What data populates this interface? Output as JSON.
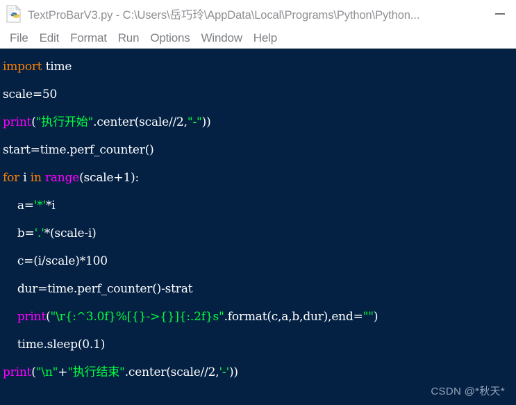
{
  "window": {
    "title": "TextProBarV3.py - C:\\Users\\岳巧玲\\AppData\\Local\\Programs\\Python\\Python...",
    "file_icon": "python-file-icon",
    "controls": [
      {
        "name": "minimize-button",
        "glyph": "minimize"
      }
    ]
  },
  "menubar": {
    "items": [
      {
        "label": "File"
      },
      {
        "label": "Edit"
      },
      {
        "label": "Format"
      },
      {
        "label": "Run"
      },
      {
        "label": "Options"
      },
      {
        "label": "Window"
      },
      {
        "label": "Help"
      }
    ]
  },
  "editor": {
    "background_color": "#042144",
    "colors": {
      "keyword": "#ff8000",
      "builtin": "#ff00ff",
      "string": "#00ff3c",
      "plain": "#ffffff"
    },
    "lines": [
      {
        "indent": "",
        "tokens": [
          {
            "t": "import",
            "c": "kw"
          },
          {
            "t": " time",
            "c": "pl"
          }
        ]
      },
      {
        "indent": "",
        "tokens": [
          {
            "t": "scale=50",
            "c": "pl"
          }
        ]
      },
      {
        "indent": "",
        "tokens": [
          {
            "t": "print",
            "c": "bi"
          },
          {
            "t": "(",
            "c": "pl"
          },
          {
            "t": "\"执行开始\"",
            "c": "str"
          },
          {
            "t": ".center(scale//2,",
            "c": "pl"
          },
          {
            "t": "\"-\"",
            "c": "str"
          },
          {
            "t": "))",
            "c": "pl"
          }
        ]
      },
      {
        "indent": "",
        "tokens": [
          {
            "t": "start=time.perf_counter()",
            "c": "pl"
          }
        ]
      },
      {
        "indent": "",
        "tokens": [
          {
            "t": "for",
            "c": "kw"
          },
          {
            "t": " i ",
            "c": "pl"
          },
          {
            "t": "in",
            "c": "kw"
          },
          {
            "t": " ",
            "c": "pl"
          },
          {
            "t": "range",
            "c": "bi"
          },
          {
            "t": "(scale+1):",
            "c": "pl"
          }
        ]
      },
      {
        "indent": "    ",
        "tokens": [
          {
            "t": "a=",
            "c": "pl"
          },
          {
            "t": "'*'",
            "c": "str"
          },
          {
            "t": "*i",
            "c": "pl"
          }
        ]
      },
      {
        "indent": "    ",
        "tokens": [
          {
            "t": "b=",
            "c": "pl"
          },
          {
            "t": "'.'",
            "c": "str"
          },
          {
            "t": "*(scale-i)",
            "c": "pl"
          }
        ]
      },
      {
        "indent": "    ",
        "tokens": [
          {
            "t": "c=(i/scale)*100",
            "c": "pl"
          }
        ]
      },
      {
        "indent": "    ",
        "tokens": [
          {
            "t": "dur=time.perf_counter()-strat",
            "c": "pl"
          }
        ]
      },
      {
        "indent": "    ",
        "tokens": [
          {
            "t": "print",
            "c": "bi"
          },
          {
            "t": "(",
            "c": "pl"
          },
          {
            "t": "\"\\r{:^3.0f}%[{}->{}]{:.2f}s\"",
            "c": "str"
          },
          {
            "t": ".format(c,a,b,dur),end=",
            "c": "pl"
          },
          {
            "t": "\"\"",
            "c": "str"
          },
          {
            "t": ")",
            "c": "pl"
          }
        ]
      },
      {
        "indent": "    ",
        "tokens": [
          {
            "t": "time.sleep(0.1)",
            "c": "pl"
          }
        ]
      },
      {
        "indent": "",
        "tokens": [
          {
            "t": "print",
            "c": "bi"
          },
          {
            "t": "(",
            "c": "pl"
          },
          {
            "t": "\"\\n\"",
            "c": "str"
          },
          {
            "t": "+",
            "c": "pl"
          },
          {
            "t": "\"执行结束\"",
            "c": "str"
          },
          {
            "t": ".center(scale//2,",
            "c": "pl"
          },
          {
            "t": "'-'",
            "c": "str"
          },
          {
            "t": "))",
            "c": "pl"
          }
        ]
      }
    ]
  },
  "watermark": {
    "text": "CSDN @*秋天*"
  }
}
